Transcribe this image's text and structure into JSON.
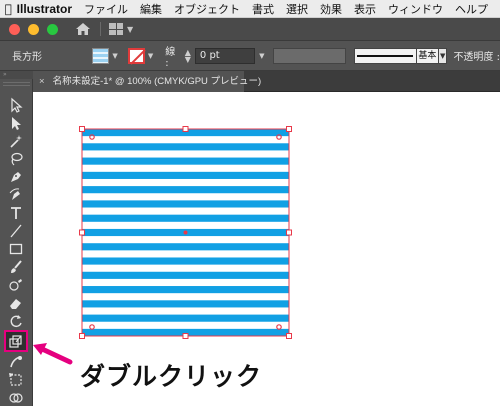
{
  "menubar": {
    "app_name": "Illustrator",
    "items": [
      "ファイル",
      "編集",
      "オブジェクト",
      "書式",
      "選択",
      "効果",
      "表示",
      "ウィンドウ",
      "ヘルプ"
    ]
  },
  "control_panel": {
    "shape_label": "長方形",
    "stroke_label": "線 :",
    "stroke_weight": "0 pt",
    "brush_label": "基本",
    "opacity_label": "不透明度 :"
  },
  "document_tab": {
    "close_symbol": "×",
    "title": "名称未設定-1* @ 100% (CMYK/GPU プレビュー)"
  },
  "annotation": {
    "text": "ダブルクリック"
  },
  "colors": {
    "stripe_blue": "#11a0e4",
    "selection_red": "#e8394a",
    "highlight_pink": "#e5007f",
    "panel_gray": "#535353"
  },
  "stripes": {
    "count": 15
  },
  "tools": [
    "selection-tool",
    "direct-selection-tool",
    "magic-wand-tool",
    "lasso-tool",
    "pen-tool",
    "curvature-tool",
    "type-tool",
    "line-segment-tool",
    "rectangle-tool",
    "paintbrush-tool",
    "shaper-tool",
    "eraser-tool",
    "rotate-tool",
    "scale-tool",
    "warp-tool",
    "free-transform-tool",
    "shape-builder-tool"
  ]
}
